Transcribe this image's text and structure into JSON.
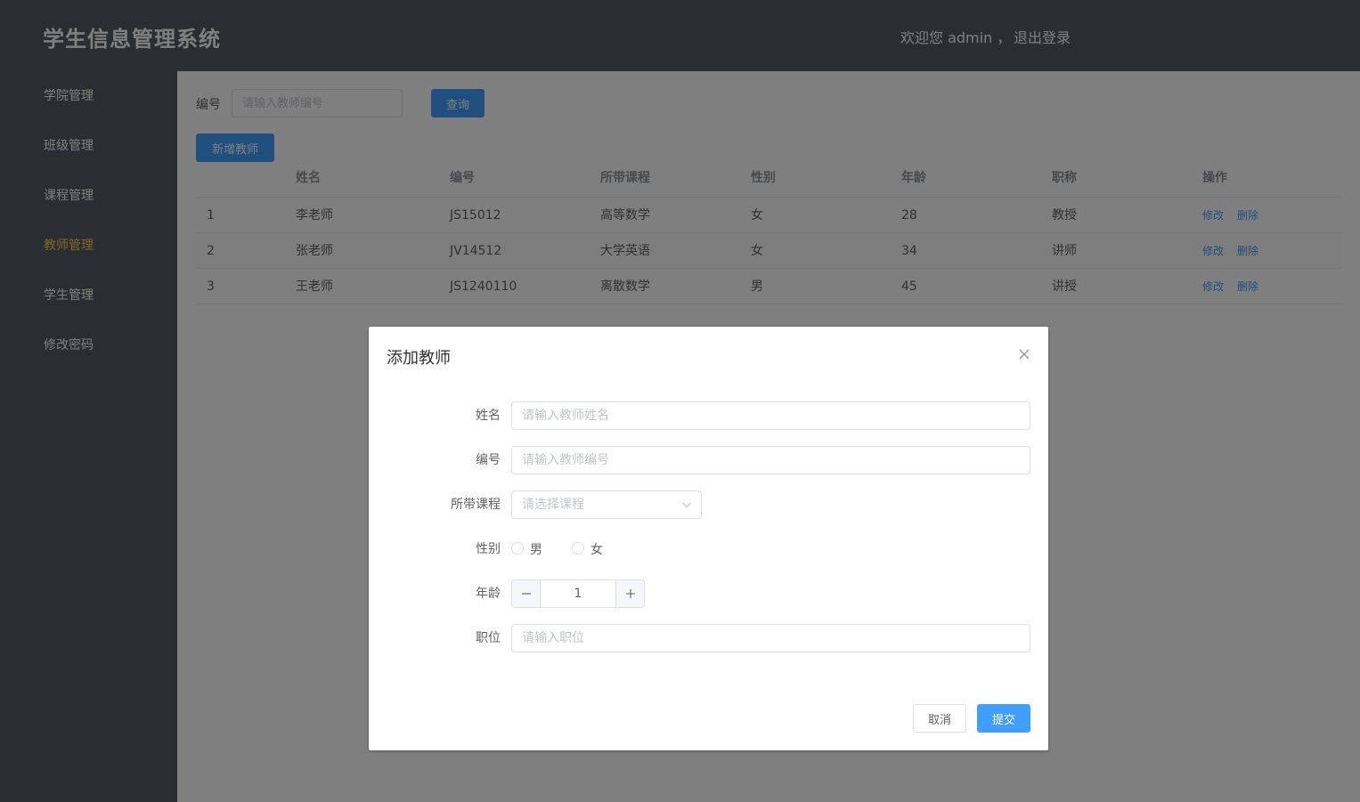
{
  "header": {
    "title": "学生信息管理系统",
    "welcome": "欢迎您 admin ，",
    "logout": "退出登录"
  },
  "sidebar": {
    "items": [
      {
        "label": "学院管理"
      },
      {
        "label": "班级管理"
      },
      {
        "label": "课程管理"
      },
      {
        "label": "教师管理"
      },
      {
        "label": "学生管理"
      },
      {
        "label": "修改密码"
      }
    ],
    "active_index": 3,
    "active_color": "#ffd04b"
  },
  "search": {
    "label": "编号",
    "placeholder": "请输入教师编号",
    "query_button": "查询",
    "add_button": "新增教师"
  },
  "table": {
    "headers": [
      "",
      "姓名",
      "编号",
      "所带课程",
      "性别",
      "年龄",
      "职称",
      "操作"
    ],
    "rows": [
      {
        "index": "1",
        "name": "李老师",
        "code": "JS15012",
        "course": "高等数学",
        "gender": "女",
        "age": "28",
        "title": "教授"
      },
      {
        "index": "2",
        "name": "张老师",
        "code": "JV14512",
        "course": "大学英语",
        "gender": "女",
        "age": "34",
        "title": "讲师"
      },
      {
        "index": "3",
        "name": "王老师",
        "code": "JS1240110",
        "course": "离散数学",
        "gender": "男",
        "age": "45",
        "title": "讲授"
      }
    ],
    "edit_label": "修改",
    "delete_label": "删除"
  },
  "dialog": {
    "title": "添加教师",
    "fields": {
      "name_label": "姓名",
      "name_placeholder": "请输入教师姓名",
      "code_label": "编号",
      "code_placeholder": "请输入教师编号",
      "course_label": "所带课程",
      "course_placeholder": "请选择课程",
      "gender_label": "性别",
      "gender_male": "男",
      "gender_female": "女",
      "age_label": "年龄",
      "age_value": "1",
      "position_label": "职位",
      "position_placeholder": "请输入职位"
    },
    "cancel_button": "取消",
    "submit_button": "提交"
  },
  "colors": {
    "primary": "#409eff",
    "header_bg": "#545c64",
    "overlay": "rgba(0,0,0,0.5)"
  }
}
